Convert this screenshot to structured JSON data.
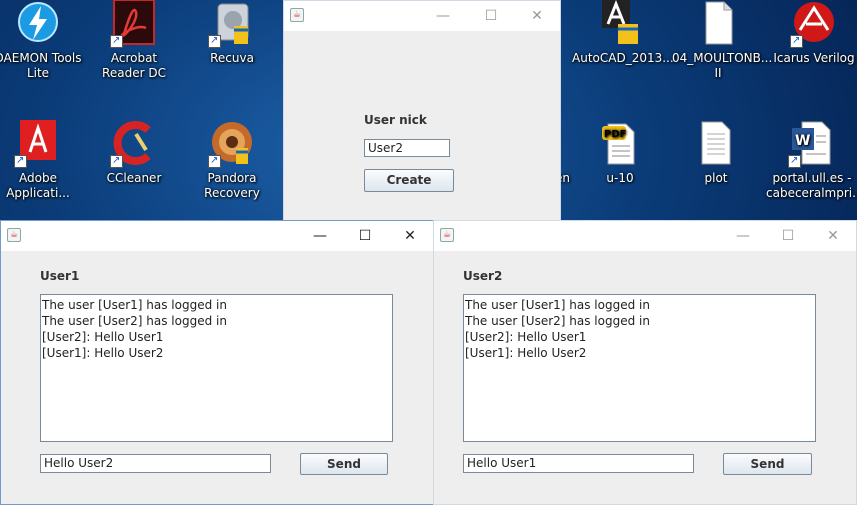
{
  "desktop": {
    "icons": [
      {
        "label": "DAEMON Tools Lite"
      },
      {
        "label": "Acrobat Reader DC"
      },
      {
        "label": "Recuva"
      },
      {
        "label": "Adobe Applicati..."
      },
      {
        "label": "CCleaner"
      },
      {
        "label": "Pandora Recovery"
      },
      {
        "label": "AutoCAD_2013..."
      },
      {
        "label": "04_MOULTONB... II"
      },
      {
        "label": "Icarus Verilog"
      },
      {
        "label": "u-10"
      },
      {
        "label": "plot"
      },
      {
        "label": "portal.ull.es - cabeceralmpri..."
      },
      {
        "label": "en"
      }
    ]
  },
  "create_window": {
    "nick_label": "User nick",
    "nick_value": "User2",
    "create_label": "Create",
    "controls": {
      "minimize": "—",
      "maximize": "☐",
      "close": "✕"
    }
  },
  "chat1": {
    "title": "User1",
    "log": "The user [User1] has logged in\nThe user [User2] has logged in\n[User2]: Hello User1\n[User1]: Hello User2",
    "message_value": "Hello User2",
    "send_label": "Send"
  },
  "chat2": {
    "title": "User2",
    "log": "The user [User1] has logged in\nThe user [User2] has logged in\n[User2]: Hello User1\n[User1]: Hello User2",
    "message_value": "Hello User1",
    "send_label": "Send"
  },
  "window_controls": {
    "minimize": "—",
    "maximize": "☐",
    "close": "✕"
  }
}
